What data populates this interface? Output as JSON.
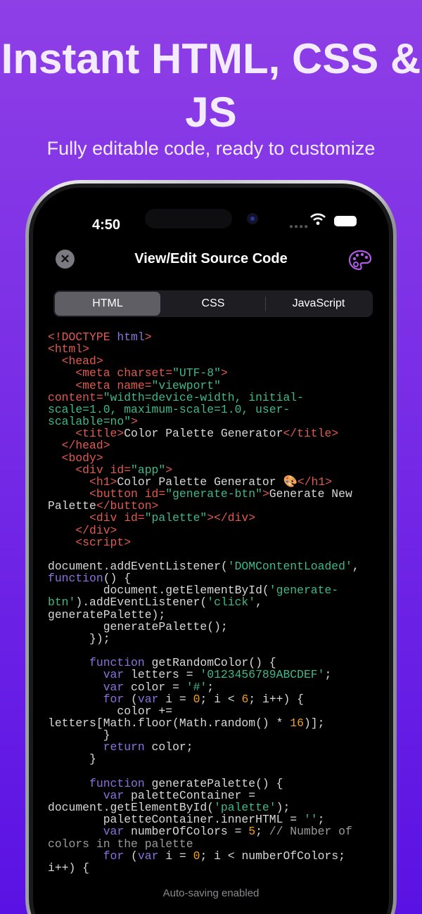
{
  "headline": "Instant HTML, CSS & JS",
  "subheadline": "Fully editable code, ready to customize",
  "status_bar": {
    "time": "4:50"
  },
  "nav": {
    "title": "View/Edit Source Code"
  },
  "tabs": [
    {
      "label": "HTML",
      "selected": true
    },
    {
      "label": "CSS",
      "selected": false
    },
    {
      "label": "JavaScript",
      "selected": false
    }
  ],
  "footer": "Auto-saving enabled",
  "colors": {
    "tag": "#e05a50",
    "string": "#40b88a",
    "keyword": "#8c72dc",
    "number": "#f0a020",
    "accent": "#b05ae8"
  },
  "code_lines": [
    [
      [
        "t",
        "<!DOCTYPE "
      ],
      [
        "d",
        "html"
      ],
      [
        "t",
        ">"
      ]
    ],
    [
      [
        "t",
        "<html>"
      ]
    ],
    [
      [
        "t",
        "  <head>"
      ]
    ],
    [
      [
        "t",
        "    <meta charset="
      ],
      [
        "s",
        "\"UTF-8\""
      ],
      [
        "t",
        ">"
      ]
    ],
    [
      [
        "t",
        "    <meta name="
      ],
      [
        "s",
        "\"viewport\""
      ]
    ],
    [
      [
        "t",
        "content="
      ],
      [
        "s",
        "\"width=device-width, initial-"
      ]
    ],
    [
      [
        "s",
        "scale=1.0, maximum-scale=1.0, user-"
      ]
    ],
    [
      [
        "s",
        "scalable=no\""
      ],
      [
        "t",
        ">"
      ]
    ],
    [
      [
        "t",
        "    <title>"
      ],
      [
        "p",
        "Color Palette Generator"
      ],
      [
        "t",
        "</title>"
      ]
    ],
    [
      [
        "t",
        "  </head>"
      ]
    ],
    [
      [
        "t",
        "  <body>"
      ]
    ],
    [
      [
        "t",
        "    <div id="
      ],
      [
        "s",
        "\"app\""
      ],
      [
        "t",
        ">"
      ]
    ],
    [
      [
        "t",
        "      <h1>"
      ],
      [
        "p",
        "Color Palette Generator 🎨"
      ],
      [
        "t",
        "</h1>"
      ]
    ],
    [
      [
        "t",
        "      <button id="
      ],
      [
        "s",
        "\"generate-btn\""
      ],
      [
        "t",
        ">"
      ],
      [
        "p",
        "Generate New"
      ]
    ],
    [
      [
        "p",
        "Palette"
      ],
      [
        "t",
        "</button>"
      ]
    ],
    [
      [
        "t",
        "      <div id="
      ],
      [
        "s",
        "\"palette\""
      ],
      [
        "t",
        "></div>"
      ]
    ],
    [
      [
        "t",
        "    </div>"
      ]
    ],
    [
      [
        "t",
        "    <script>"
      ]
    ],
    [
      [
        "p",
        ""
      ]
    ],
    [
      [
        "p",
        "document.addEventListener("
      ],
      [
        "s",
        "'DOMContentLoaded'"
      ],
      [
        "p",
        ","
      ]
    ],
    [
      [
        "k",
        "function"
      ],
      [
        "p",
        "() {"
      ]
    ],
    [
      [
        "p",
        "        document.getElementById("
      ],
      [
        "s",
        "'generate-"
      ]
    ],
    [
      [
        "s",
        "btn'"
      ],
      [
        "p",
        ").addEventListener("
      ],
      [
        "s",
        "'click'"
      ],
      [
        "p",
        ","
      ]
    ],
    [
      [
        "p",
        "generatePalette);"
      ]
    ],
    [
      [
        "p",
        "        generatePalette();"
      ]
    ],
    [
      [
        "p",
        "      });"
      ]
    ],
    [
      [
        "p",
        ""
      ]
    ],
    [
      [
        "k",
        "      function"
      ],
      [
        "p",
        " getRandomColor() {"
      ]
    ],
    [
      [
        "k",
        "        var"
      ],
      [
        "p",
        " letters = "
      ],
      [
        "s",
        "'0123456789ABCDEF'"
      ],
      [
        "p",
        ";"
      ]
    ],
    [
      [
        "k",
        "        var"
      ],
      [
        "p",
        " color = "
      ],
      [
        "s",
        "'#'"
      ],
      [
        "p",
        ";"
      ]
    ],
    [
      [
        "k",
        "        for"
      ],
      [
        "p",
        " ("
      ],
      [
        "k",
        "var"
      ],
      [
        "p",
        " i = "
      ],
      [
        "n",
        "0"
      ],
      [
        "p",
        "; i < "
      ],
      [
        "n",
        "6"
      ],
      [
        "p",
        "; i++) {"
      ]
    ],
    [
      [
        "p",
        "          color +="
      ]
    ],
    [
      [
        "p",
        "letters[Math.floor(Math.random() * "
      ],
      [
        "n",
        "16"
      ],
      [
        "p",
        ")];"
      ]
    ],
    [
      [
        "p",
        "        }"
      ]
    ],
    [
      [
        "k",
        "        return"
      ],
      [
        "p",
        " color;"
      ]
    ],
    [
      [
        "p",
        "      }"
      ]
    ],
    [
      [
        "p",
        ""
      ]
    ],
    [
      [
        "k",
        "      function"
      ],
      [
        "p",
        " generatePalette() {"
      ]
    ],
    [
      [
        "k",
        "        var"
      ],
      [
        "p",
        " paletteContainer ="
      ]
    ],
    [
      [
        "p",
        "document.getElementById("
      ],
      [
        "s",
        "'palette'"
      ],
      [
        "p",
        ");"
      ]
    ],
    [
      [
        "p",
        "        paletteContainer.innerHTML = "
      ],
      [
        "s",
        "''"
      ],
      [
        "p",
        ";"
      ]
    ],
    [
      [
        "k",
        "        var"
      ],
      [
        "p",
        " numberOfColors = "
      ],
      [
        "n",
        "5"
      ],
      [
        "p",
        "; "
      ],
      [
        "c",
        "// Number of"
      ]
    ],
    [
      [
        "c",
        "colors in the palette"
      ]
    ],
    [
      [
        "k",
        "        for"
      ],
      [
        "p",
        " ("
      ],
      [
        "k",
        "var"
      ],
      [
        "p",
        " i = "
      ],
      [
        "n",
        "0"
      ],
      [
        "p",
        "; i < numberOfColors;"
      ]
    ],
    [
      [
        "p",
        "i++) {"
      ]
    ]
  ]
}
